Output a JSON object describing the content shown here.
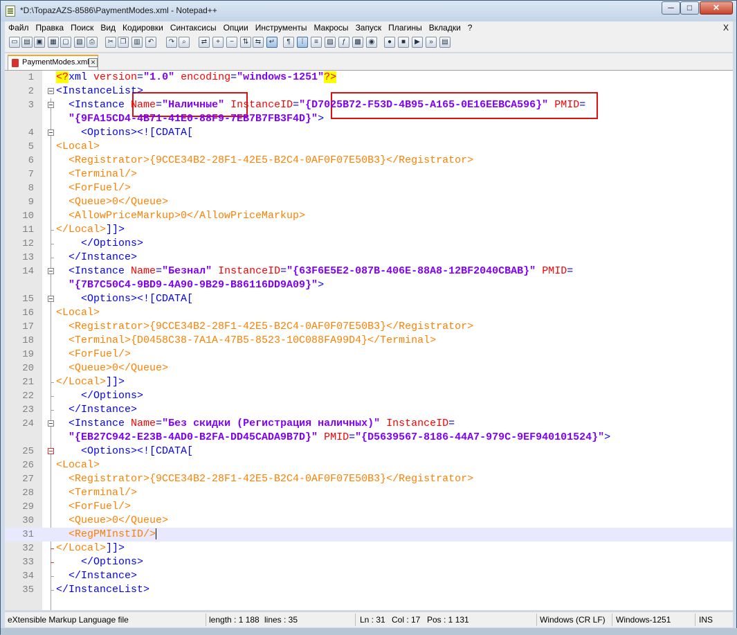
{
  "window": {
    "title": "*D:\\TopazAZS-8586\\PaymentModes.xml - Notepad++",
    "minimize": "─",
    "maximize": "□",
    "close": "✕"
  },
  "menu": {
    "items": [
      "Файл",
      "Правка",
      "Поиск",
      "Вид",
      "Кодировки",
      "Синтаксисы",
      "Опции",
      "Инструменты",
      "Макросы",
      "Запуск",
      "Плагины",
      "Вкладки",
      "?"
    ],
    "close": "X"
  },
  "toolbar": {
    "icons": [
      "new-file-icon",
      "open-file-icon",
      "save-icon",
      "save-all-icon",
      "close-file-icon",
      "close-all-icon",
      "print-icon",
      "cut-icon",
      "copy-icon",
      "paste-icon",
      "undo-icon",
      "redo-icon",
      "find-icon",
      "replace-icon",
      "zoom-in-icon",
      "zoom-out-icon",
      "sync-vertical-icon",
      "sync-horizontal-icon",
      "word-wrap-icon",
      "show-all-chars-icon",
      "indent-guide-icon",
      "user-language-icon",
      "doc-map-icon",
      "function-list-icon",
      "folder-workspace-icon",
      "monitoring-icon",
      "record-macro-icon",
      "stop-macro-icon",
      "play-macro-icon",
      "run-macro-multiple-icon",
      "save-macro-icon"
    ]
  },
  "tab": {
    "label": "PaymentModes.xml",
    "close": "✕"
  },
  "editor": {
    "lines": [
      {
        "num": "1",
        "parts": [
          [
            "pi",
            "<?"
          ],
          [
            "t",
            "xml "
          ],
          [
            "a",
            "version"
          ],
          [
            "t",
            "="
          ],
          [
            "v",
            "\"1.0\""
          ],
          [
            "t",
            " "
          ],
          [
            "a",
            "encoding"
          ],
          [
            "t",
            "="
          ],
          [
            "v",
            "\"windows-1251\""
          ],
          [
            "pi",
            "?>"
          ]
        ]
      },
      {
        "num": "2",
        "parts": [
          [
            "t",
            "<InstanceList>"
          ]
        ]
      },
      {
        "num": "3",
        "parts": [
          [
            "t",
            "  <Instance "
          ],
          [
            "a",
            "Name"
          ],
          [
            "t",
            "="
          ],
          [
            "v",
            "\"Наличные\""
          ],
          [
            "t",
            " "
          ],
          [
            "a",
            "InstanceID"
          ],
          [
            "t",
            "="
          ],
          [
            "v",
            "\"{D7025B72-F53D-4B95-A165-0E16EEBCA596}\""
          ],
          [
            "t",
            " "
          ],
          [
            "a",
            "PMID"
          ],
          [
            "t",
            "="
          ]
        ]
      },
      {
        "num": "",
        "parts": [
          [
            "v",
            "  \"{9FA15CD4-4B71-41E0-88F9-7EB7B7FB3F4D}\""
          ],
          [
            "t",
            ">"
          ]
        ]
      },
      {
        "num": "4",
        "parts": [
          [
            "t",
            "    <Options>"
          ],
          [
            "t",
            "<![CDATA["
          ]
        ]
      },
      {
        "num": "5",
        "parts": [
          [
            "o",
            "<Local>"
          ]
        ]
      },
      {
        "num": "6",
        "parts": [
          [
            "o",
            "  <Registrator>{9CCE34B2-28F1-42E5-B2C4-0AF0F07E50B3}</Registrator>"
          ]
        ]
      },
      {
        "num": "7",
        "parts": [
          [
            "o",
            "  <Terminal/>"
          ]
        ]
      },
      {
        "num": "8",
        "parts": [
          [
            "o",
            "  <ForFuel/>"
          ]
        ]
      },
      {
        "num": "9",
        "parts": [
          [
            "o",
            "  <Queue>0</Queue>"
          ]
        ]
      },
      {
        "num": "10",
        "parts": [
          [
            "o",
            "  <AllowPriceMarkup>0</AllowPriceMarkup>"
          ]
        ]
      },
      {
        "num": "11",
        "parts": [
          [
            "o",
            "</Local>"
          ],
          [
            "t",
            "]]>"
          ]
        ]
      },
      {
        "num": "12",
        "parts": [
          [
            "t",
            "    </Options>"
          ]
        ]
      },
      {
        "num": "13",
        "parts": [
          [
            "t",
            "  </Instance>"
          ]
        ]
      },
      {
        "num": "14",
        "parts": [
          [
            "t",
            "  <Instance "
          ],
          [
            "a",
            "Name"
          ],
          [
            "t",
            "="
          ],
          [
            "v",
            "\"Безнал\""
          ],
          [
            "t",
            " "
          ],
          [
            "a",
            "InstanceID"
          ],
          [
            "t",
            "="
          ],
          [
            "v",
            "\"{63F6E5E2-087B-406E-88A8-12BF2040CBAB}\""
          ],
          [
            "t",
            " "
          ],
          [
            "a",
            "PMID"
          ],
          [
            "t",
            "="
          ]
        ]
      },
      {
        "num": "",
        "parts": [
          [
            "v",
            "  \"{7B7C50C4-9BD9-4A90-9B29-B86116DD9A09}\""
          ],
          [
            "t",
            ">"
          ]
        ]
      },
      {
        "num": "15",
        "parts": [
          [
            "t",
            "    <Options>"
          ],
          [
            "t",
            "<![CDATA["
          ]
        ]
      },
      {
        "num": "16",
        "parts": [
          [
            "o",
            "<Local>"
          ]
        ]
      },
      {
        "num": "17",
        "parts": [
          [
            "o",
            "  <Registrator>{9CCE34B2-28F1-42E5-B2C4-0AF0F07E50B3}</Registrator>"
          ]
        ]
      },
      {
        "num": "18",
        "parts": [
          [
            "o",
            "  <Terminal>{D0458C38-7A1A-47B5-8523-10C088FA99D4}</Terminal>"
          ]
        ]
      },
      {
        "num": "19",
        "parts": [
          [
            "o",
            "  <ForFuel/>"
          ]
        ]
      },
      {
        "num": "20",
        "parts": [
          [
            "o",
            "  <Queue>0</Queue>"
          ]
        ]
      },
      {
        "num": "21",
        "parts": [
          [
            "o",
            "</Local>"
          ],
          [
            "t",
            "]]>"
          ]
        ]
      },
      {
        "num": "22",
        "parts": [
          [
            "t",
            "    </Options>"
          ]
        ]
      },
      {
        "num": "23",
        "parts": [
          [
            "t",
            "  </Instance>"
          ]
        ]
      },
      {
        "num": "24",
        "parts": [
          [
            "t",
            "  <Instance "
          ],
          [
            "a",
            "Name"
          ],
          [
            "t",
            "="
          ],
          [
            "v",
            "\"Без скидки (Регистрация наличных)\""
          ],
          [
            "t",
            " "
          ],
          [
            "a",
            "InstanceID"
          ],
          [
            "t",
            "="
          ]
        ]
      },
      {
        "num": "",
        "parts": [
          [
            "v",
            "  \"{EB27C942-E23B-4AD0-B2FA-DD45CADA9B7D}\""
          ],
          [
            "t",
            " "
          ],
          [
            "a",
            "PMID"
          ],
          [
            "t",
            "="
          ],
          [
            "v",
            "\"{D5639567-8186-44A7-979C-9EF940101524}\""
          ],
          [
            "t",
            ">"
          ]
        ]
      },
      {
        "num": "25",
        "parts": [
          [
            "t",
            "    <Options>"
          ],
          [
            "t",
            "<![CDATA["
          ]
        ]
      },
      {
        "num": "26",
        "parts": [
          [
            "o",
            "<Local>"
          ]
        ]
      },
      {
        "num": "27",
        "parts": [
          [
            "o",
            "  <Registrator>{9CCE34B2-28F1-42E5-B2C4-0AF0F07E50B3}</Registrator>"
          ]
        ]
      },
      {
        "num": "28",
        "parts": [
          [
            "o",
            "  <Terminal/>"
          ]
        ]
      },
      {
        "num": "29",
        "parts": [
          [
            "o",
            "  <ForFuel/>"
          ]
        ]
      },
      {
        "num": "30",
        "parts": [
          [
            "o",
            "  <Queue>0</Queue>"
          ]
        ]
      },
      {
        "num": "31",
        "parts": [
          [
            "o",
            "  <RegPMInstID/>"
          ]
        ]
      },
      {
        "num": "32",
        "parts": [
          [
            "o",
            "</Local>"
          ],
          [
            "t",
            "]]>"
          ]
        ]
      },
      {
        "num": "33",
        "parts": [
          [
            "t",
            "    </Options>"
          ]
        ]
      },
      {
        "num": "34",
        "parts": [
          [
            "t",
            "  </Instance>"
          ]
        ]
      },
      {
        "num": "35",
        "parts": [
          [
            "t",
            "</InstanceList>"
          ]
        ]
      }
    ],
    "current_line": "31"
  },
  "status": {
    "filetype": "eXtensible Markup Language file",
    "length": "length : 1 188",
    "lines": "lines : 35",
    "ln": "Ln : 31",
    "col": "Col : 17",
    "pos": "Pos : 1 131",
    "eol": "Windows (CR LF)",
    "encoding": "Windows-1251",
    "mode": "INS"
  },
  "colors": {
    "tag": "#0000ff",
    "attribute": "#ff0000",
    "value": "#8000ff",
    "cdata": "#ff8000",
    "highlight_box": "#e01010"
  }
}
